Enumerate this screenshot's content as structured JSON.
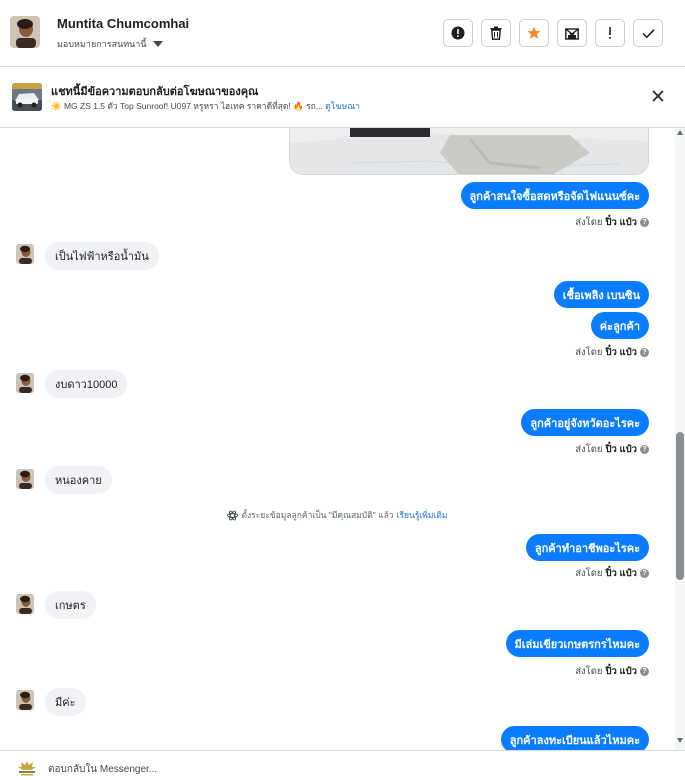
{
  "header": {
    "name": "Muntita Chumcomhai",
    "subtitle": "มอบหมายการสนทนานี้",
    "actions": [
      {
        "name": "spam-alert-button",
        "icon": "alert-circle-icon"
      },
      {
        "name": "delete-button",
        "icon": "trash-icon"
      },
      {
        "name": "star-button",
        "icon": "star-icon"
      },
      {
        "name": "mark-unread-button",
        "icon": "envelope-x-icon"
      },
      {
        "name": "follow-up-button",
        "icon": "exclamation-icon"
      },
      {
        "name": "done-button",
        "icon": "check-icon"
      }
    ]
  },
  "banner": {
    "title": "แชทนี้มีข้อความตอบกลับต่อโฆษณาของคุณ",
    "subtitle": "☀️ MG ZS 1.5 ตัว Top Sunroof! U097 หรูหรา ไฮเทค ราคาดีที่สุด! 🔥 รถ...",
    "link": "ดูโฆษณา"
  },
  "messages": {
    "m1": "ลูกค้าสนใจซื้อสดหรือจัดไฟแนนซ์คะ",
    "m2": "เป็นไฟฟ้าหรือน้ำมัน",
    "m3": "เชื้อเพลิง เบนซิน",
    "m4": "ค่ะลูกค้า",
    "m5": "งบดาว10000",
    "m6": "ลูกค้าอยู่จังหวัดอะไรคะ",
    "m7": "หนองคาย",
    "m8": "ลูกค้าทำอาชีพอะไรคะ",
    "m9": "เกษตร",
    "m10": "มีเล่มเขียวเกษตรกรไหมคะ",
    "m11": "มีค่ะ",
    "m12": "ลูกค้าลงทะเบียนแล้วไหมคะ"
  },
  "sent_by": {
    "prefix": "ส่งโดย",
    "agent": "ปิ๋ว แป๋ว"
  },
  "system_note": {
    "text": "ตั้งระยะข้อมูลลูกค้าเป็น \"มีคุณสมบัติ\" แล้ว",
    "link": "เรียนรู้เพิ่มเติม"
  },
  "footer": {
    "placeholder": "ตอบกลับใน Messenger..."
  },
  "colors": {
    "outgoing_bubble": "#0a7cff",
    "incoming_bubble": "#f0f2f5",
    "link": "#216fdb",
    "star": "#f0892a"
  }
}
